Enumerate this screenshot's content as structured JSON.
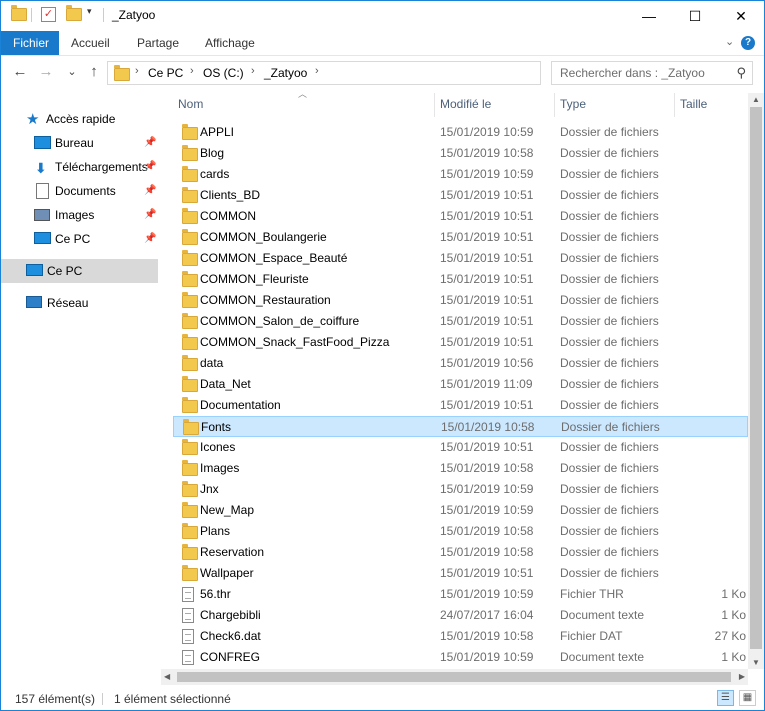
{
  "window": {
    "title": "_Zatyoo",
    "minimize": "—",
    "maximize": "☐",
    "close": "✕"
  },
  "ribbon": {
    "tabs": [
      "Fichier",
      "Accueil",
      "Partage",
      "Affichage"
    ],
    "expand": "⌄",
    "help": "?"
  },
  "nav_buttons": {
    "back": "←",
    "forward": "→",
    "recent": "⌄",
    "up": "↑"
  },
  "address": {
    "crumbs": [
      "Ce PC",
      "OS (C:)",
      "_Zatyoo"
    ],
    "separator": "›"
  },
  "search": {
    "placeholder": "Rechercher dans : _Zatyoo"
  },
  "navpane": {
    "items": [
      {
        "label": "Accès rapide",
        "icon": "star-icon",
        "pinned": false
      },
      {
        "label": "Bureau",
        "icon": "desktop-icon",
        "pinned": true
      },
      {
        "label": "Téléchargements",
        "icon": "download-icon",
        "pinned": true
      },
      {
        "label": "Documents",
        "icon": "documents-icon",
        "pinned": true
      },
      {
        "label": "Images",
        "icon": "pictures-icon",
        "pinned": true
      },
      {
        "label": "Ce PC",
        "icon": "computer-icon",
        "pinned": true
      },
      {
        "label": "Ce PC",
        "icon": "computer-icon",
        "pinned": false
      },
      {
        "label": "Réseau",
        "icon": "network-icon",
        "pinned": false
      }
    ]
  },
  "columns": {
    "name": "Nom",
    "modified": "Modifié le",
    "type": "Type",
    "size": "Taille"
  },
  "files": [
    {
      "name": "APPLI",
      "date": "15/01/2019 10:59",
      "type": "Dossier de fichiers",
      "size": "",
      "kind": "folder"
    },
    {
      "name": "Blog",
      "date": "15/01/2019 10:58",
      "type": "Dossier de fichiers",
      "size": "",
      "kind": "folder"
    },
    {
      "name": "cards",
      "date": "15/01/2019 10:59",
      "type": "Dossier de fichiers",
      "size": "",
      "kind": "folder"
    },
    {
      "name": "Clients_BD",
      "date": "15/01/2019 10:51",
      "type": "Dossier de fichiers",
      "size": "",
      "kind": "folder"
    },
    {
      "name": "COMMON",
      "date": "15/01/2019 10:51",
      "type": "Dossier de fichiers",
      "size": "",
      "kind": "folder"
    },
    {
      "name": "COMMON_Boulangerie",
      "date": "15/01/2019 10:51",
      "type": "Dossier de fichiers",
      "size": "",
      "kind": "folder"
    },
    {
      "name": "COMMON_Espace_Beauté",
      "date": "15/01/2019 10:51",
      "type": "Dossier de fichiers",
      "size": "",
      "kind": "folder"
    },
    {
      "name": "COMMON_Fleuriste",
      "date": "15/01/2019 10:51",
      "type": "Dossier de fichiers",
      "size": "",
      "kind": "folder"
    },
    {
      "name": "COMMON_Restauration",
      "date": "15/01/2019 10:51",
      "type": "Dossier de fichiers",
      "size": "",
      "kind": "folder"
    },
    {
      "name": "COMMON_Salon_de_coiffure",
      "date": "15/01/2019 10:51",
      "type": "Dossier de fichiers",
      "size": "",
      "kind": "folder"
    },
    {
      "name": "COMMON_Snack_FastFood_Pizza",
      "date": "15/01/2019 10:51",
      "type": "Dossier de fichiers",
      "size": "",
      "kind": "folder"
    },
    {
      "name": "data",
      "date": "15/01/2019 10:56",
      "type": "Dossier de fichiers",
      "size": "",
      "kind": "folder"
    },
    {
      "name": "Data_Net",
      "date": "15/01/2019 11:09",
      "type": "Dossier de fichiers",
      "size": "",
      "kind": "folder"
    },
    {
      "name": "Documentation",
      "date": "15/01/2019 10:51",
      "type": "Dossier de fichiers",
      "size": "",
      "kind": "folder"
    },
    {
      "name": "Fonts",
      "date": "15/01/2019 10:58",
      "type": "Dossier de fichiers",
      "size": "",
      "kind": "folder",
      "selected": true
    },
    {
      "name": "Icones",
      "date": "15/01/2019 10:51",
      "type": "Dossier de fichiers",
      "size": "",
      "kind": "folder"
    },
    {
      "name": "Images",
      "date": "15/01/2019 10:58",
      "type": "Dossier de fichiers",
      "size": "",
      "kind": "folder"
    },
    {
      "name": "Jnx",
      "date": "15/01/2019 10:59",
      "type": "Dossier de fichiers",
      "size": "",
      "kind": "folder"
    },
    {
      "name": "New_Map",
      "date": "15/01/2019 10:59",
      "type": "Dossier de fichiers",
      "size": "",
      "kind": "folder"
    },
    {
      "name": "Plans",
      "date": "15/01/2019 10:58",
      "type": "Dossier de fichiers",
      "size": "",
      "kind": "folder"
    },
    {
      "name": "Reservation",
      "date": "15/01/2019 10:58",
      "type": "Dossier de fichiers",
      "size": "",
      "kind": "folder"
    },
    {
      "name": "Wallpaper",
      "date": "15/01/2019 10:51",
      "type": "Dossier de fichiers",
      "size": "",
      "kind": "folder"
    },
    {
      "name": "56.thr",
      "date": "15/01/2019 10:59",
      "type": "Fichier THR",
      "size": "1 Ko",
      "kind": "file"
    },
    {
      "name": "Chargebibli",
      "date": "24/07/2017 16:04",
      "type": "Document texte",
      "size": "1 Ko",
      "kind": "file"
    },
    {
      "name": "Check6.dat",
      "date": "15/01/2019 10:58",
      "type": "Fichier DAT",
      "size": "27 Ko",
      "kind": "file"
    },
    {
      "name": "CONFREG",
      "date": "15/01/2019 10:59",
      "type": "Document texte",
      "size": "1 Ko",
      "kind": "file"
    }
  ],
  "status": {
    "count": "157 élément(s)",
    "selection": "1 élément sélectionné"
  },
  "colors": {
    "accent": "#1979ca",
    "selection": "#cce8ff",
    "selection_border": "#99d1ff",
    "header_text": "#4c607a"
  }
}
